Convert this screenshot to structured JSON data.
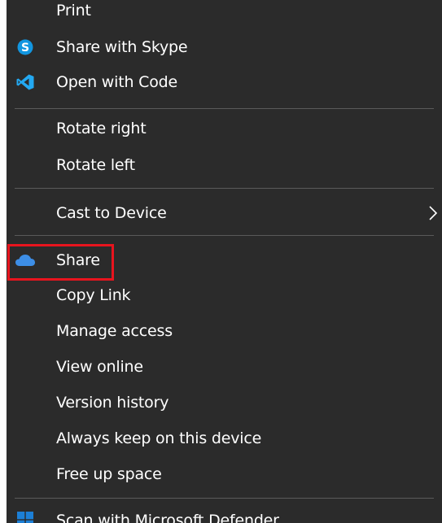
{
  "menu": {
    "items": [
      {
        "label": "Print"
      },
      {
        "label": "Share with Skype",
        "icon": "skype-icon"
      },
      {
        "label": "Open with Code",
        "icon": "vscode-icon"
      },
      {
        "label": "Rotate right"
      },
      {
        "label": "Rotate left"
      },
      {
        "label": "Cast to Device",
        "submenu": true
      },
      {
        "label": "Share",
        "icon": "onedrive-cloud-icon",
        "highlighted": true
      },
      {
        "label": "Copy Link"
      },
      {
        "label": "Manage access"
      },
      {
        "label": "View online"
      },
      {
        "label": "Version history"
      },
      {
        "label": "Always keep on this device"
      },
      {
        "label": "Free up space"
      },
      {
        "label": "Scan with Microsoft Defender",
        "icon": "windows-defender-icon"
      }
    ]
  },
  "colors": {
    "menu_background": "#2b2b2b",
    "text": "#ffffff",
    "separator": "#5a5a5a",
    "highlight_box": "#e8141e",
    "skype_blue": "#1296e0",
    "vscode_blue": "#23a9f2",
    "onedrive_blue": "#3d8ee6",
    "defender_blue": "#1c7fd6"
  }
}
